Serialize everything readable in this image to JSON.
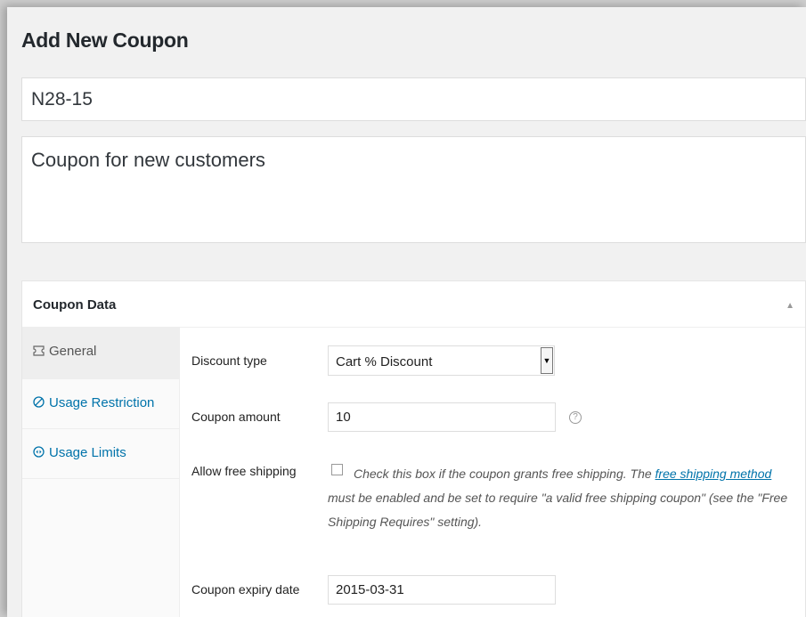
{
  "page": {
    "title": "Add New Coupon"
  },
  "coupon": {
    "code": "N28-15",
    "description": "Coupon for new customers"
  },
  "coupon_data": {
    "title": "Coupon Data",
    "tabs": [
      {
        "label": "General",
        "icon": "ticket-icon",
        "active": true
      },
      {
        "label": "Usage Restriction",
        "icon": "restriction-icon",
        "active": false
      },
      {
        "label": "Usage Limits",
        "icon": "limits-icon",
        "active": false
      }
    ],
    "fields": {
      "discount_type": {
        "label": "Discount type",
        "value": "Cart % Discount"
      },
      "coupon_amount": {
        "label": "Coupon amount",
        "value": "10"
      },
      "free_shipping": {
        "label": "Allow free shipping",
        "checked": false,
        "desc_before": "Check this box if the coupon grants free shipping. The ",
        "link_text": "free shipping method",
        "desc_after": " must be enabled and be set to require \"a valid free shipping coupon\" (see the \"Free Shipping Requires\" setting)."
      },
      "expiry_date": {
        "label": "Coupon expiry date",
        "value": "2015-03-31"
      }
    }
  }
}
